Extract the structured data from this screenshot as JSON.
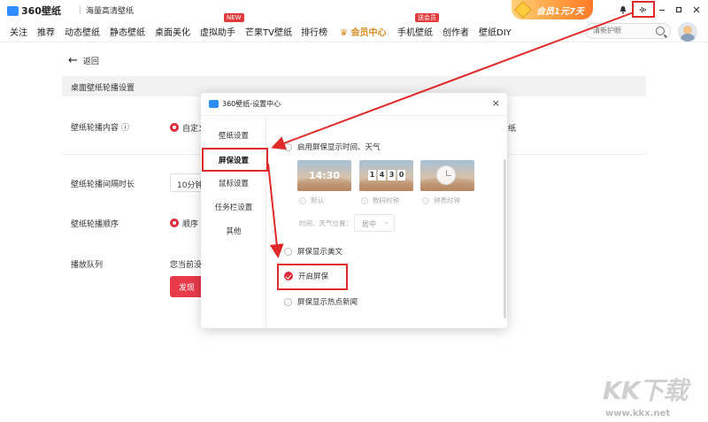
{
  "app": {
    "logo_text": "360壁纸",
    "slogan": "海量高清壁纸",
    "vip_banner": "会员1元7天"
  },
  "nav": {
    "items": [
      "关注",
      "推荐",
      "动态壁纸",
      "静态壁纸",
      "桌面美化",
      "虚拟助手",
      "芒果TV壁纸",
      "排行榜",
      "会员中心",
      "手机壁纸",
      "创作者",
      "壁纸DIY"
    ],
    "badge_new": "NEW",
    "badge_sub": "送会员",
    "search_placeholder": "清新护眼"
  },
  "page": {
    "back_label": "返回",
    "section_title": "桌面壁纸轮播设置",
    "rows": {
      "content_label": "壁纸轮播内容",
      "content_value": "自定义",
      "content_right": "纸",
      "interval_label": "壁纸轮播间隔时长",
      "interval_value": "10分钟",
      "order_label": "壁纸轮播顺序",
      "order_value": "顺序",
      "queue_label": "播放队列",
      "queue_text": "您当前没",
      "discover_button": "发现"
    }
  },
  "dialog": {
    "title": "360壁纸-设置中心",
    "close": "×",
    "sidebar": [
      "壁纸设置",
      "屏保设置",
      "鼠标设置",
      "任务栏设置",
      "其他"
    ],
    "options": {
      "show_time_weather": "启用屏保显示时间、天气",
      "clock_styles": [
        "默认",
        "数码时钟",
        "钟表时钟"
      ],
      "default_clock_time": "14:30",
      "digital_clock_digits": [
        "1",
        "4",
        "3",
        "0"
      ],
      "position_label": "时间、天气位置：",
      "position_value": "居中",
      "show_quotes": "屏保显示美文",
      "enable_screensaver": "开启屏保",
      "show_news": "屏保显示热点新闻"
    }
  },
  "watermark": {
    "logo": "KK下载",
    "url": "www.kkx.net"
  },
  "colors": {
    "accent_red": "#e02a2a",
    "brand_blue": "#2f8cff",
    "vip_orange": "#ff9b3d"
  }
}
